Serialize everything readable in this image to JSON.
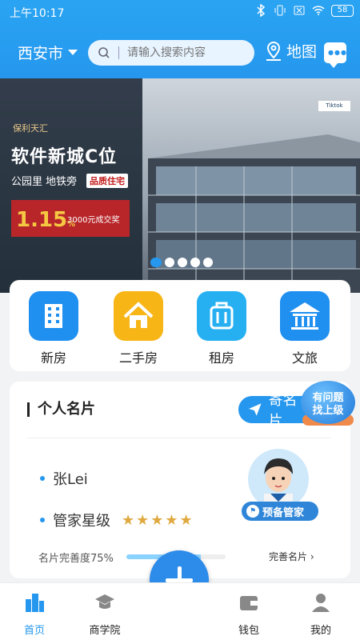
{
  "status_bar": {
    "time": "上午10:17",
    "battery": "58"
  },
  "header": {
    "city": "西安市",
    "search_placeholder": "请输入搜索内容",
    "map_label": "地图"
  },
  "banner": {
    "brand": "保利天汇",
    "title": "软件新城C位",
    "subtitle": "公园里 地铁旁",
    "tag": "品质住宅",
    "promo_rate": "1.15",
    "promo_rate_unit": "%",
    "promo_amount": "3000元成交奖",
    "logo_text": "Tiktok",
    "slide_count": 5,
    "active_slide": 0
  },
  "quick_nav": [
    {
      "label": "新房",
      "color": "#1f8ff0",
      "icon": "building-icon"
    },
    {
      "label": "二手房",
      "color": "#f7b516",
      "icon": "house-icon"
    },
    {
      "label": "租房",
      "color": "#26b0f2",
      "icon": "suitcase-icon"
    },
    {
      "label": "文旅",
      "color": "#1f8ff0",
      "icon": "pavilion-icon"
    }
  ],
  "card": {
    "title": "个人名片",
    "send_label": "寄名片",
    "name": "张Lei",
    "level_label": "管家星级",
    "stars": "★★★★★",
    "progress_label": "名片完善度75%",
    "progress": 0.75,
    "complete_link": "完善名片 ›",
    "steward_label": "预备管家"
  },
  "help": {
    "text": "有问题\n找上级"
  },
  "bottom_nav": [
    {
      "label": "首页",
      "active": true
    },
    {
      "label": "商学院",
      "active": false
    },
    {
      "label": "钱包",
      "active": false
    },
    {
      "label": "我的",
      "active": false
    }
  ],
  "colors": {
    "primary": "#2597ee",
    "accent_yellow": "#f7b516",
    "star": "#e0a93f"
  }
}
